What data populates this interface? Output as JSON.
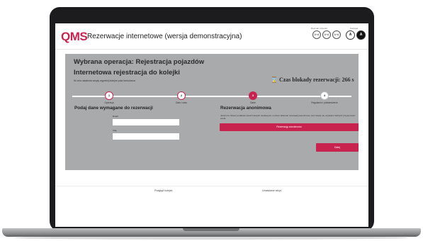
{
  "header": {
    "logo": "QMS",
    "title": "Rezerwacje internetowe (wersja demonstracyjna)",
    "font_size_label": "Rozmiar czcionki",
    "font_buttons": [
      "A+A",
      "A+A",
      "A+A"
    ],
    "contrast_label": "Kontrast",
    "contrast_buttons": [
      "A",
      "A"
    ]
  },
  "panel": {
    "operation": "Wybrana operacja: Rejestracja pojazdów",
    "subtitle": "Internetowa rejestracja do kolejki",
    "hint": "W celu ustalenia wizyty wypełnij kolejne pola formularza",
    "timer_icon": "hourglass-icon",
    "timer": "Czas blokady rezerwacji: 266 s"
  },
  "steps": [
    {
      "number": "1",
      "label": "Operacja",
      "state": "done"
    },
    {
      "number": "2",
      "label": "Data i czas",
      "state": "done"
    },
    {
      "number": "3",
      "label": "Dane",
      "state": "active"
    },
    {
      "number": "4",
      "label": "Regulamin i potwierdzenie",
      "state": "future"
    }
  ],
  "form": {
    "title": "Podaj dane wymagane do rezerwacji",
    "email_label": "Email",
    "email_value": "",
    "name_label": "Imię",
    "name_value": ""
  },
  "anonymous": {
    "title": "Rezerwacja anonimowa",
    "description": "Jeżeli nie chcesz podawać swoich danych osobowych, możesz dokonać rezerwacji anonimowo, lecz wtedy nie uzyskasz żadnych przypomnień email.",
    "button": "Rezerwuję anonimowo"
  },
  "next_button": "Dalej",
  "footer": {
    "left": "Podgląd kolejek",
    "right": "Umawianie wizyt"
  },
  "colors": {
    "accent": "#c8234f",
    "panel": "#a9aaac"
  }
}
